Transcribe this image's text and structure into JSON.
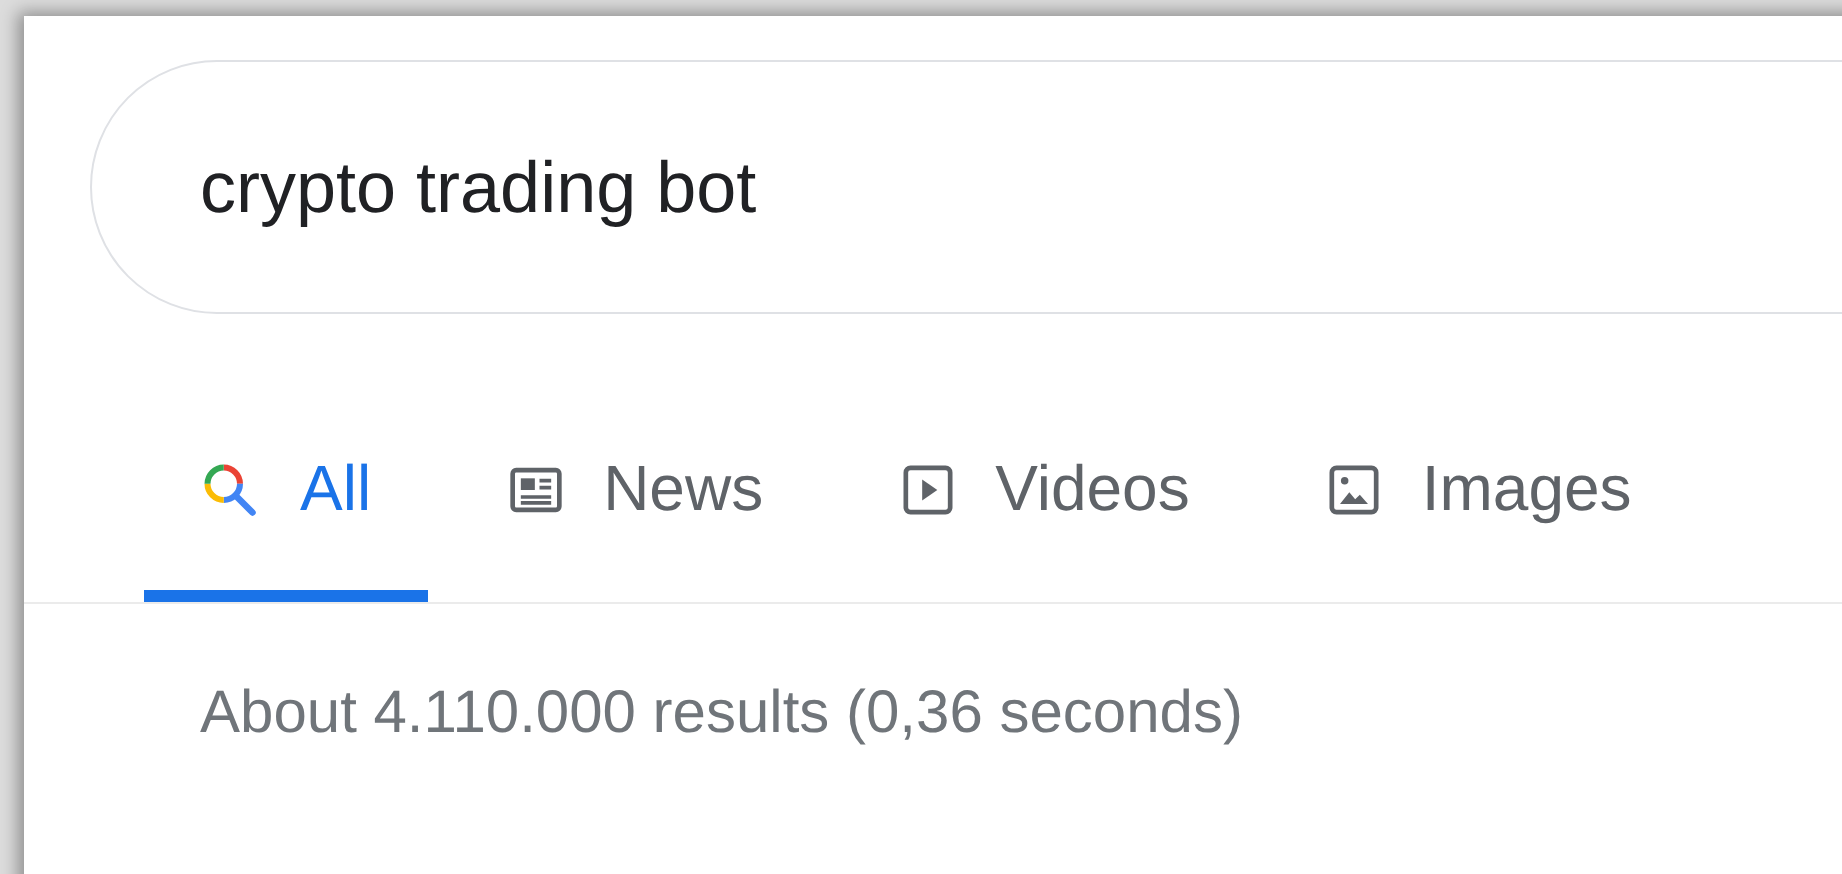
{
  "search": {
    "value": "crypto trading bot"
  },
  "tabs": [
    {
      "label": "All",
      "kind": "all",
      "selected": true
    },
    {
      "label": "News",
      "kind": "news",
      "selected": false
    },
    {
      "label": "Videos",
      "kind": "videos",
      "selected": false
    },
    {
      "label": "Images",
      "kind": "images",
      "selected": false
    }
  ],
  "result_stats": "About 4.110.000 results (0,36 seconds)"
}
